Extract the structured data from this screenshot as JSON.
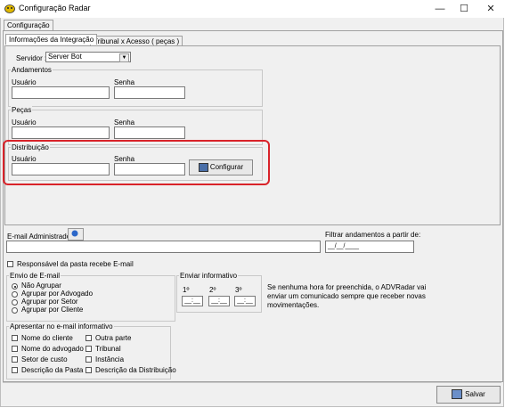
{
  "window": {
    "title": "Configuração Radar",
    "min": "—",
    "max": "☐",
    "close": "✕"
  },
  "tabs": {
    "outer": "Configuração",
    "inner1": "Informações da Integração",
    "inner2": "Tribunal x Acesso ( peças )"
  },
  "servidor": {
    "label": "Servidor :",
    "value": "Server Bot"
  },
  "andamentos": {
    "title": "Andamentos",
    "user": "Usuário",
    "pass": "Senha"
  },
  "pecas": {
    "title": "Peças",
    "user": "Usuário",
    "pass": "Senha"
  },
  "distribuicao": {
    "title": "Distribuição",
    "user": "Usuário",
    "pass": "Senha",
    "button": "Configurar"
  },
  "email": {
    "label": "E-mail Administrador",
    "filter_label": "Filtrar andamentos a partir de:",
    "filter_value": "__/__/____"
  },
  "responsavel": "Responsável da pasta recebe E-mail",
  "envio": {
    "title": "Envio de E-mail",
    "options": [
      "Não Agrupar",
      "Agrupar por Advogado",
      "Agrupar por Setor",
      "Agrupar por Cliente"
    ]
  },
  "enviar": {
    "title": "Enviar informativo",
    "h1": "1º",
    "h2": "2º",
    "h3": "3º",
    "time": "__:__",
    "note": "Se nenhuma hora for preenchida, o ADVRadar vai enviar um comunicado sempre que receber novas movimentações."
  },
  "apresentar": {
    "title": "Apresentar no e-mail informativo",
    "left": [
      "Nome do cliente",
      "Nome do advogado",
      "Setor de custo",
      "Descrição da Pasta"
    ],
    "right": [
      "Outra parte",
      "Tribunal",
      "Instância",
      "Descrição da Distribuição"
    ]
  },
  "salvar": "Salvar"
}
